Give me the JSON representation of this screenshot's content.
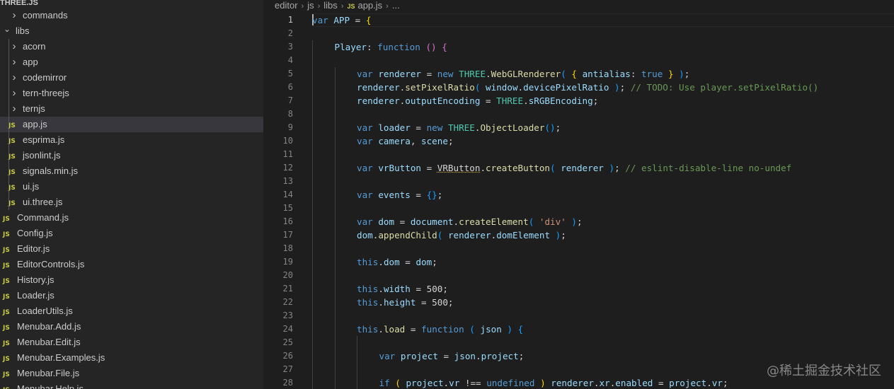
{
  "explorer": {
    "project_title": "THREE.JS",
    "items": [
      {
        "label": "commands",
        "type": "folder",
        "collapsed": true,
        "indent": 1
      },
      {
        "label": "libs",
        "type": "folder",
        "collapsed": false,
        "indent": 0
      },
      {
        "label": "acorn",
        "type": "folder",
        "collapsed": true,
        "indent": 1
      },
      {
        "label": "app",
        "type": "folder",
        "collapsed": true,
        "indent": 1
      },
      {
        "label": "codemirror",
        "type": "folder",
        "collapsed": true,
        "indent": 1
      },
      {
        "label": "tern-threejs",
        "type": "folder",
        "collapsed": true,
        "indent": 1
      },
      {
        "label": "ternjs",
        "type": "folder",
        "collapsed": true,
        "indent": 1
      },
      {
        "label": "app.js",
        "type": "file",
        "indent": 1,
        "selected": true
      },
      {
        "label": "esprima.js",
        "type": "file",
        "indent": 1
      },
      {
        "label": "jsonlint.js",
        "type": "file",
        "indent": 1
      },
      {
        "label": "signals.min.js",
        "type": "file",
        "indent": 1
      },
      {
        "label": "ui.js",
        "type": "file",
        "indent": 1
      },
      {
        "label": "ui.three.js",
        "type": "file",
        "indent": 1
      },
      {
        "label": "Command.js",
        "type": "file",
        "indent": 0
      },
      {
        "label": "Config.js",
        "type": "file",
        "indent": 0
      },
      {
        "label": "Editor.js",
        "type": "file",
        "indent": 0
      },
      {
        "label": "EditorControls.js",
        "type": "file",
        "indent": 0
      },
      {
        "label": "History.js",
        "type": "file",
        "indent": 0
      },
      {
        "label": "Loader.js",
        "type": "file",
        "indent": 0
      },
      {
        "label": "LoaderUtils.js",
        "type": "file",
        "indent": 0
      },
      {
        "label": "Menubar.Add.js",
        "type": "file",
        "indent": 0
      },
      {
        "label": "Menubar.Edit.js",
        "type": "file",
        "indent": 0
      },
      {
        "label": "Menubar.Examples.js",
        "type": "file",
        "indent": 0
      },
      {
        "label": "Menubar.File.js",
        "type": "file",
        "indent": 0
      },
      {
        "label": "Menubar.Help.js",
        "type": "file",
        "indent": 0
      }
    ]
  },
  "breadcrumb": {
    "parts": [
      "editor",
      "js",
      "libs",
      "app.js",
      "..."
    ],
    "file_icon": "JS"
  },
  "icons": {
    "chevron_right": "chevron-right-icon",
    "chevron_down": "chevron-down-icon",
    "js_file": "js-file-icon"
  },
  "editor": {
    "active_line": 1,
    "lines": [
      {
        "n": "1",
        "indent": 0,
        "tokens": [
          [
            "kw",
            "var"
          ],
          [
            "pun",
            " "
          ],
          [
            "var",
            "APP"
          ],
          [
            "pun",
            " = "
          ],
          [
            "brk1",
            "{"
          ]
        ]
      },
      {
        "n": "2",
        "indent": 0,
        "tokens": []
      },
      {
        "n": "3",
        "indent": 1,
        "tokens": [
          [
            "prop",
            "Player"
          ],
          [
            "pun",
            ": "
          ],
          [
            "kw",
            "function"
          ],
          [
            "pun",
            " "
          ],
          [
            "brk2",
            "()"
          ],
          [
            "pun",
            " "
          ],
          [
            "brk2",
            "{"
          ]
        ]
      },
      {
        "n": "4",
        "indent": 1,
        "tokens": []
      },
      {
        "n": "5",
        "indent": 2,
        "tokens": [
          [
            "kw",
            "var"
          ],
          [
            "pun",
            " "
          ],
          [
            "var",
            "renderer"
          ],
          [
            "pun",
            " = "
          ],
          [
            "kw",
            "new"
          ],
          [
            "pun",
            " "
          ],
          [
            "cls",
            "THREE"
          ],
          [
            "pun",
            "."
          ],
          [
            "fn",
            "WebGLRenderer"
          ],
          [
            "brk3",
            "("
          ],
          [
            "pun",
            " "
          ],
          [
            "brk1",
            "{"
          ],
          [
            "pun",
            " "
          ],
          [
            "prop",
            "antialias"
          ],
          [
            "pun",
            ": "
          ],
          [
            "kw",
            "true"
          ],
          [
            "pun",
            " "
          ],
          [
            "brk1",
            "}"
          ],
          [
            "pun",
            " "
          ],
          [
            "brk3",
            ")"
          ],
          [
            "pun",
            ";"
          ]
        ]
      },
      {
        "n": "6",
        "indent": 2,
        "tokens": [
          [
            "var",
            "renderer"
          ],
          [
            "pun",
            "."
          ],
          [
            "fn",
            "setPixelRatio"
          ],
          [
            "brk3",
            "("
          ],
          [
            "pun",
            " "
          ],
          [
            "var",
            "window"
          ],
          [
            "pun",
            "."
          ],
          [
            "prop",
            "devicePixelRatio"
          ],
          [
            "pun",
            " "
          ],
          [
            "brk3",
            ")"
          ],
          [
            "pun",
            "; "
          ],
          [
            "cmt",
            "// TODO: Use player.setPixelRatio()"
          ]
        ]
      },
      {
        "n": "7",
        "indent": 2,
        "tokens": [
          [
            "var",
            "renderer"
          ],
          [
            "pun",
            "."
          ],
          [
            "prop",
            "outputEncoding"
          ],
          [
            "pun",
            " = "
          ],
          [
            "cls",
            "THREE"
          ],
          [
            "pun",
            "."
          ],
          [
            "prop",
            "sRGBEncoding"
          ],
          [
            "pun",
            ";"
          ]
        ]
      },
      {
        "n": "8",
        "indent": 2,
        "tokens": []
      },
      {
        "n": "9",
        "indent": 2,
        "tokens": [
          [
            "kw",
            "var"
          ],
          [
            "pun",
            " "
          ],
          [
            "var",
            "loader"
          ],
          [
            "pun",
            " = "
          ],
          [
            "kw",
            "new"
          ],
          [
            "pun",
            " "
          ],
          [
            "cls",
            "THREE"
          ],
          [
            "pun",
            "."
          ],
          [
            "fn",
            "ObjectLoader"
          ],
          [
            "brk3",
            "()"
          ],
          [
            "pun",
            ";"
          ]
        ]
      },
      {
        "n": "10",
        "indent": 2,
        "tokens": [
          [
            "kw",
            "var"
          ],
          [
            "pun",
            " "
          ],
          [
            "var",
            "camera"
          ],
          [
            "pun",
            ", "
          ],
          [
            "var",
            "scene"
          ],
          [
            "pun",
            ";"
          ]
        ]
      },
      {
        "n": "11",
        "indent": 2,
        "tokens": []
      },
      {
        "n": "12",
        "indent": 2,
        "tokens": [
          [
            "kw",
            "var"
          ],
          [
            "pun",
            " "
          ],
          [
            "var",
            "vrButton"
          ],
          [
            "pun",
            " = "
          ],
          [
            "squig",
            "VRButton"
          ],
          [
            "pun",
            "."
          ],
          [
            "fn",
            "createButton"
          ],
          [
            "brk3",
            "("
          ],
          [
            "pun",
            " "
          ],
          [
            "var",
            "renderer"
          ],
          [
            "pun",
            " "
          ],
          [
            "brk3",
            ")"
          ],
          [
            "pun",
            "; "
          ],
          [
            "cmt",
            "// eslint-disable-line no-undef"
          ]
        ]
      },
      {
        "n": "13",
        "indent": 2,
        "tokens": []
      },
      {
        "n": "14",
        "indent": 2,
        "tokens": [
          [
            "kw",
            "var"
          ],
          [
            "pun",
            " "
          ],
          [
            "var",
            "events"
          ],
          [
            "pun",
            " = "
          ],
          [
            "brk3",
            "{}"
          ],
          [
            "pun",
            ";"
          ]
        ]
      },
      {
        "n": "15",
        "indent": 2,
        "tokens": []
      },
      {
        "n": "16",
        "indent": 2,
        "tokens": [
          [
            "kw",
            "var"
          ],
          [
            "pun",
            " "
          ],
          [
            "var",
            "dom"
          ],
          [
            "pun",
            " = "
          ],
          [
            "var",
            "document"
          ],
          [
            "pun",
            "."
          ],
          [
            "fn",
            "createElement"
          ],
          [
            "brk3",
            "("
          ],
          [
            "pun",
            " "
          ],
          [
            "str",
            "'div'"
          ],
          [
            "pun",
            " "
          ],
          [
            "brk3",
            ")"
          ],
          [
            "pun",
            ";"
          ]
        ]
      },
      {
        "n": "17",
        "indent": 2,
        "tokens": [
          [
            "var",
            "dom"
          ],
          [
            "pun",
            "."
          ],
          [
            "fn",
            "appendChild"
          ],
          [
            "brk3",
            "("
          ],
          [
            "pun",
            " "
          ],
          [
            "var",
            "renderer"
          ],
          [
            "pun",
            "."
          ],
          [
            "prop",
            "domElement"
          ],
          [
            "pun",
            " "
          ],
          [
            "brk3",
            ")"
          ],
          [
            "pun",
            ";"
          ]
        ]
      },
      {
        "n": "18",
        "indent": 2,
        "tokens": []
      },
      {
        "n": "19",
        "indent": 2,
        "tokens": [
          [
            "kw",
            "this"
          ],
          [
            "pun",
            "."
          ],
          [
            "prop",
            "dom"
          ],
          [
            "pun",
            " = "
          ],
          [
            "var",
            "dom"
          ],
          [
            "pun",
            ";"
          ]
        ]
      },
      {
        "n": "20",
        "indent": 2,
        "tokens": []
      },
      {
        "n": "21",
        "indent": 2,
        "tokens": [
          [
            "kw",
            "this"
          ],
          [
            "pun",
            "."
          ],
          [
            "prop",
            "width"
          ],
          [
            "pun",
            " = 500;"
          ]
        ]
      },
      {
        "n": "22",
        "indent": 2,
        "tokens": [
          [
            "kw",
            "this"
          ],
          [
            "pun",
            "."
          ],
          [
            "prop",
            "height"
          ],
          [
            "pun",
            " = 500;"
          ]
        ]
      },
      {
        "n": "23",
        "indent": 2,
        "tokens": []
      },
      {
        "n": "24",
        "indent": 2,
        "tokens": [
          [
            "kw",
            "this"
          ],
          [
            "pun",
            "."
          ],
          [
            "fn",
            "load"
          ],
          [
            "pun",
            " = "
          ],
          [
            "kw",
            "function"
          ],
          [
            "pun",
            " "
          ],
          [
            "brk3",
            "("
          ],
          [
            "pun",
            " "
          ],
          [
            "var",
            "json"
          ],
          [
            "pun",
            " "
          ],
          [
            "brk3",
            ")"
          ],
          [
            "pun",
            " "
          ],
          [
            "brk3",
            "{"
          ]
        ]
      },
      {
        "n": "25",
        "indent": 3,
        "tokens": []
      },
      {
        "n": "26",
        "indent": 3,
        "tokens": [
          [
            "kw",
            "var"
          ],
          [
            "pun",
            " "
          ],
          [
            "var",
            "project"
          ],
          [
            "pun",
            " = "
          ],
          [
            "var",
            "json"
          ],
          [
            "pun",
            "."
          ],
          [
            "prop",
            "project"
          ],
          [
            "pun",
            ";"
          ]
        ]
      },
      {
        "n": "27",
        "indent": 3,
        "tokens": []
      },
      {
        "n": "28",
        "indent": 3,
        "tokens": [
          [
            "kw",
            "if"
          ],
          [
            "pun",
            " "
          ],
          [
            "brk1",
            "("
          ],
          [
            "pun",
            " "
          ],
          [
            "var",
            "project"
          ],
          [
            "pun",
            "."
          ],
          [
            "prop",
            "vr"
          ],
          [
            "pun",
            " !== "
          ],
          [
            "kw",
            "undefined"
          ],
          [
            "pun",
            " "
          ],
          [
            "brk1",
            ")"
          ],
          [
            "pun",
            " "
          ],
          [
            "var",
            "renderer"
          ],
          [
            "pun",
            "."
          ],
          [
            "prop",
            "xr"
          ],
          [
            "pun",
            "."
          ],
          [
            "prop",
            "enabled"
          ],
          [
            "pun",
            " = "
          ],
          [
            "var",
            "project"
          ],
          [
            "pun",
            "."
          ],
          [
            "prop",
            "vr"
          ],
          [
            "pun",
            ";"
          ]
        ]
      }
    ]
  },
  "watermark": "@稀土掘金技术社区"
}
